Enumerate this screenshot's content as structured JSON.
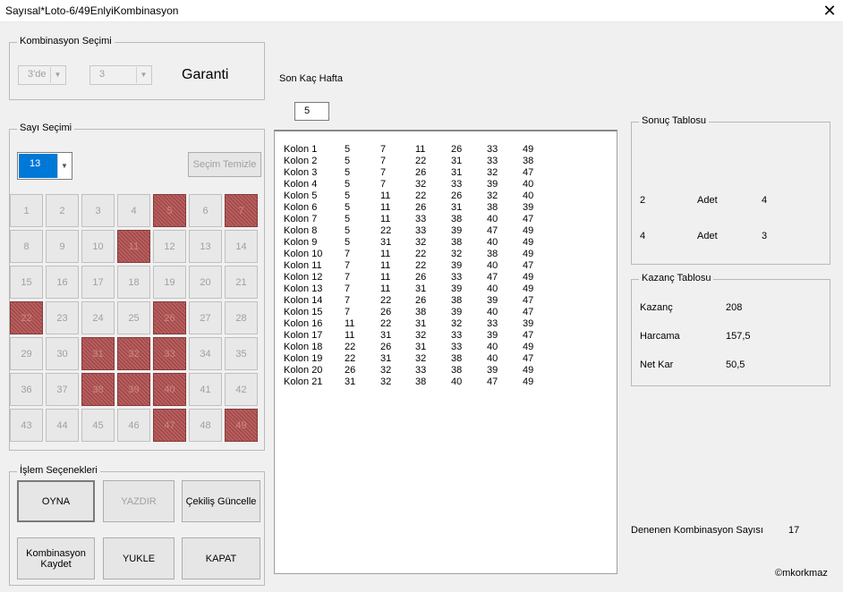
{
  "window": {
    "title": "Sayısal*Loto-6/49EnlyiKombinasyon",
    "close_glyph": "✕"
  },
  "kombinasyon": {
    "legend": "Kombinasyon Seçimi",
    "combo1": "3'de",
    "combo2": "3",
    "garanti_label": "Garanti"
  },
  "son_kac_hafta": {
    "label": "Son Kaç Hafta",
    "value": "5"
  },
  "sayi_secimi": {
    "legend": "Sayı Seçimi",
    "count_value": "13",
    "clear_button": "Seçim Temizle",
    "numbers": [
      "1",
      "2",
      "3",
      "4",
      "5",
      "6",
      "7",
      "8",
      "9",
      "10",
      "11",
      "12",
      "13",
      "14",
      "15",
      "16",
      "17",
      "18",
      "19",
      "20",
      "21",
      "22",
      "23",
      "24",
      "25",
      "26",
      "27",
      "28",
      "29",
      "30",
      "31",
      "32",
      "33",
      "34",
      "35",
      "36",
      "37",
      "38",
      "39",
      "40",
      "41",
      "42",
      "43",
      "44",
      "45",
      "46",
      "47",
      "48",
      "49"
    ],
    "selected": [
      "5",
      "7",
      "11",
      "22",
      "26",
      "31",
      "32",
      "33",
      "38",
      "39",
      "40",
      "47",
      "49"
    ]
  },
  "islem": {
    "legend": "İşlem Seçenekleri",
    "oyna": "OYNA",
    "yazdir": "YAZDIR",
    "cekilis": "Çekiliş Güncelle",
    "kaydet": "Kombinasyon Kaydet",
    "yukle": "YUKLE",
    "kapat": "KAPAT"
  },
  "kolonlar": [
    {
      "name": "Kolon 1",
      "nums": [
        "5",
        "7",
        "11",
        "26",
        "33",
        "49"
      ]
    },
    {
      "name": "Kolon 2",
      "nums": [
        "5",
        "7",
        "22",
        "31",
        "33",
        "38"
      ]
    },
    {
      "name": "Kolon 3",
      "nums": [
        "5",
        "7",
        "26",
        "31",
        "32",
        "47"
      ]
    },
    {
      "name": "Kolon 4",
      "nums": [
        "5",
        "7",
        "32",
        "33",
        "39",
        "40"
      ]
    },
    {
      "name": "Kolon 5",
      "nums": [
        "5",
        "11",
        "22",
        "26",
        "32",
        "40"
      ]
    },
    {
      "name": "Kolon 6",
      "nums": [
        "5",
        "11",
        "26",
        "31",
        "38",
        "39"
      ]
    },
    {
      "name": "Kolon 7",
      "nums": [
        "5",
        "11",
        "33",
        "38",
        "40",
        "47"
      ]
    },
    {
      "name": "Kolon 8",
      "nums": [
        "5",
        "22",
        "33",
        "39",
        "47",
        "49"
      ]
    },
    {
      "name": "Kolon 9",
      "nums": [
        "5",
        "31",
        "32",
        "38",
        "40",
        "49"
      ]
    },
    {
      "name": "Kolon 10",
      "nums": [
        "7",
        "11",
        "22",
        "32",
        "38",
        "49"
      ]
    },
    {
      "name": "Kolon 11",
      "nums": [
        "7",
        "11",
        "22",
        "39",
        "40",
        "47"
      ]
    },
    {
      "name": "Kolon 12",
      "nums": [
        "7",
        "11",
        "26",
        "33",
        "47",
        "49"
      ]
    },
    {
      "name": "Kolon 13",
      "nums": [
        "7",
        "11",
        "31",
        "39",
        "40",
        "49"
      ]
    },
    {
      "name": "Kolon 14",
      "nums": [
        "7",
        "22",
        "26",
        "38",
        "39",
        "47"
      ]
    },
    {
      "name": "Kolon 15",
      "nums": [
        "7",
        "26",
        "38",
        "39",
        "40",
        "47"
      ]
    },
    {
      "name": "Kolon 16",
      "nums": [
        "11",
        "22",
        "31",
        "32",
        "33",
        "39"
      ]
    },
    {
      "name": "Kolon 17",
      "nums": [
        "11",
        "31",
        "32",
        "33",
        "39",
        "47"
      ]
    },
    {
      "name": "Kolon 18",
      "nums": [
        "22",
        "26",
        "31",
        "33",
        "40",
        "49"
      ]
    },
    {
      "name": "Kolon 19",
      "nums": [
        "22",
        "31",
        "32",
        "38",
        "40",
        "47"
      ]
    },
    {
      "name": "Kolon 20",
      "nums": [
        "26",
        "32",
        "33",
        "38",
        "39",
        "49"
      ]
    },
    {
      "name": "Kolon 21",
      "nums": [
        "31",
        "32",
        "38",
        "40",
        "47",
        "49"
      ]
    }
  ],
  "sonuc": {
    "legend": "Sonuç Tablosu",
    "rows": [
      {
        "a": "2",
        "b": "Adet",
        "c": "4"
      },
      {
        "a": "4",
        "b": "Adet",
        "c": "3"
      }
    ]
  },
  "kazanc": {
    "legend": "Kazanç Tablosu",
    "rows": [
      {
        "label": "Kazanç",
        "value": "208"
      },
      {
        "label": "Harcama",
        "value": "157,5"
      },
      {
        "label": "Net Kar",
        "value": "50,5"
      }
    ]
  },
  "denenen": {
    "label": "Denenen Kombinasyon Sayısı",
    "value": "17"
  },
  "copyright": "©mkorkmaz",
  "colors": {
    "selected_cell": "#a84a4a",
    "count_combo": "#0078d7"
  }
}
